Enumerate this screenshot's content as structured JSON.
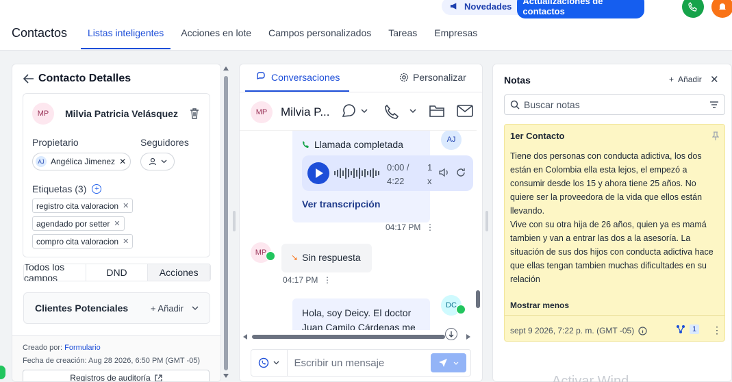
{
  "header": {
    "news_label": "Novedades",
    "news_pill": "Actualizaciones de contactos",
    "title": "Contactos",
    "tabs": [
      "Listas inteligentes",
      "Acciones en lote",
      "Campos personalizados",
      "Tareas",
      "Empresas"
    ],
    "active_tab": "Listas inteligentes"
  },
  "left": {
    "heading": "Contacto Detalles",
    "contact": {
      "initials": "MP",
      "name": "Milvia Patricia Velásquez"
    },
    "owner_label": "Propietario",
    "followers_label": "Seguidores",
    "owner": {
      "initials": "AJ",
      "name": "Angélica Jimenez"
    },
    "tags_label": "Etiquetas (3)",
    "tags": [
      "registro cita valoracion",
      "agendado por setter",
      "compro cita valoracion"
    ],
    "segments": [
      "Todos los campos",
      "DND",
      "Acciones"
    ],
    "active_segment": "Acciones",
    "leads_title": "Clientes Potenciales",
    "leads_add": "Añadir",
    "created_by_prefix": "Creado por:",
    "created_by": "Formulario",
    "created_date": "Fecha de creación: Aug 28 2026, 6:50 PM (GMT -05)",
    "audit": "Registros de auditoría"
  },
  "mid": {
    "tab_conversations": "Conversaciones",
    "tab_customize": "Personalizar",
    "chat_name": "Milvia P...",
    "chat_initials": "MP",
    "call_title": "Llamada completada",
    "audio_time": "0:00 / 4:22",
    "audio_speed": "1 x",
    "transcript": "Ver transcripción",
    "time1": "04:17 PM",
    "no_answer": "Sin respuesta",
    "time2": "04:17 PM",
    "msg": "Hola, soy Deicy. El doctor Juan Camilo Cárdenas me",
    "agent1": "AJ",
    "agent2": "DC",
    "placeholder": "Escribir un mensaje"
  },
  "right": {
    "title": "Notas",
    "add": "Añadir",
    "search_placeholder": "Buscar notas",
    "note_title": "1er Contacto",
    "note_body": "Tiene dos personas con conducta adictiva, los dos están en Colombia ella esta lejos, el empezó a consumir desde los 15 y ahora tiene 25 años. No quiere ser la proveedora de la vida que ellos están llevando.\nVive con su otra hija de 26 años, quien ya es mamá tambien y van a entrar las dos a la asesoría. La situación de sus dos hijos con conducta adictiva hace que ellas tengan tambien muchas dificultades en su relación",
    "show_less": "Mostrar menos",
    "note_date": "sept 9 2026, 7:22 p. m. (GMT -05)",
    "link_count": "1"
  },
  "watermark": "Activar Wind",
  "colors": {
    "accent": "#1d4ed8",
    "note_bg": "#fdf6c5",
    "whatsapp": "#22c55e"
  }
}
